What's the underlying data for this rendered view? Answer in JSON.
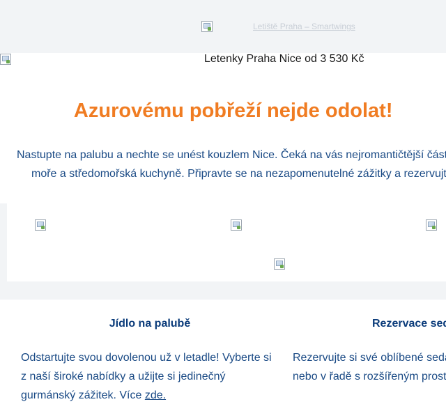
{
  "header": {
    "logo_alt": "Letiště Praha – Smartwings"
  },
  "subheader": {
    "text": "Letenky Praha Nice od 3 530 Kč"
  },
  "hero": {
    "headline": "Azurovému pobřeží nejde odolat!",
    "intro_line1": "Nastupte na palubu a nechte se unést kouzlem Nice. Čeká na vás nejromantičtější část",
    "intro_line2": "moře a středomořská kuchyně. Připravte se na nezapomenutelné zážitky a rezervujte"
  },
  "gallery": {
    "images": [
      "photo-1",
      "photo-2",
      "photo-3",
      "photo-4"
    ]
  },
  "features": [
    {
      "title": "Jídlo na palubě",
      "body_line1": "Odstartujte svou dovolenou už v letadle! Vyberte si",
      "body_line2": "z naší široké nabídky a užijte si jedinečný",
      "body_line3_prefix": "gurmánský zážitek. Více ",
      "link_text": "zde."
    },
    {
      "title": "Rezervace sed",
      "body_line1": "Rezervujte si své oblíbené seda",
      "body_line2": "nebo v řadě s rozšířeným prost"
    }
  ]
}
